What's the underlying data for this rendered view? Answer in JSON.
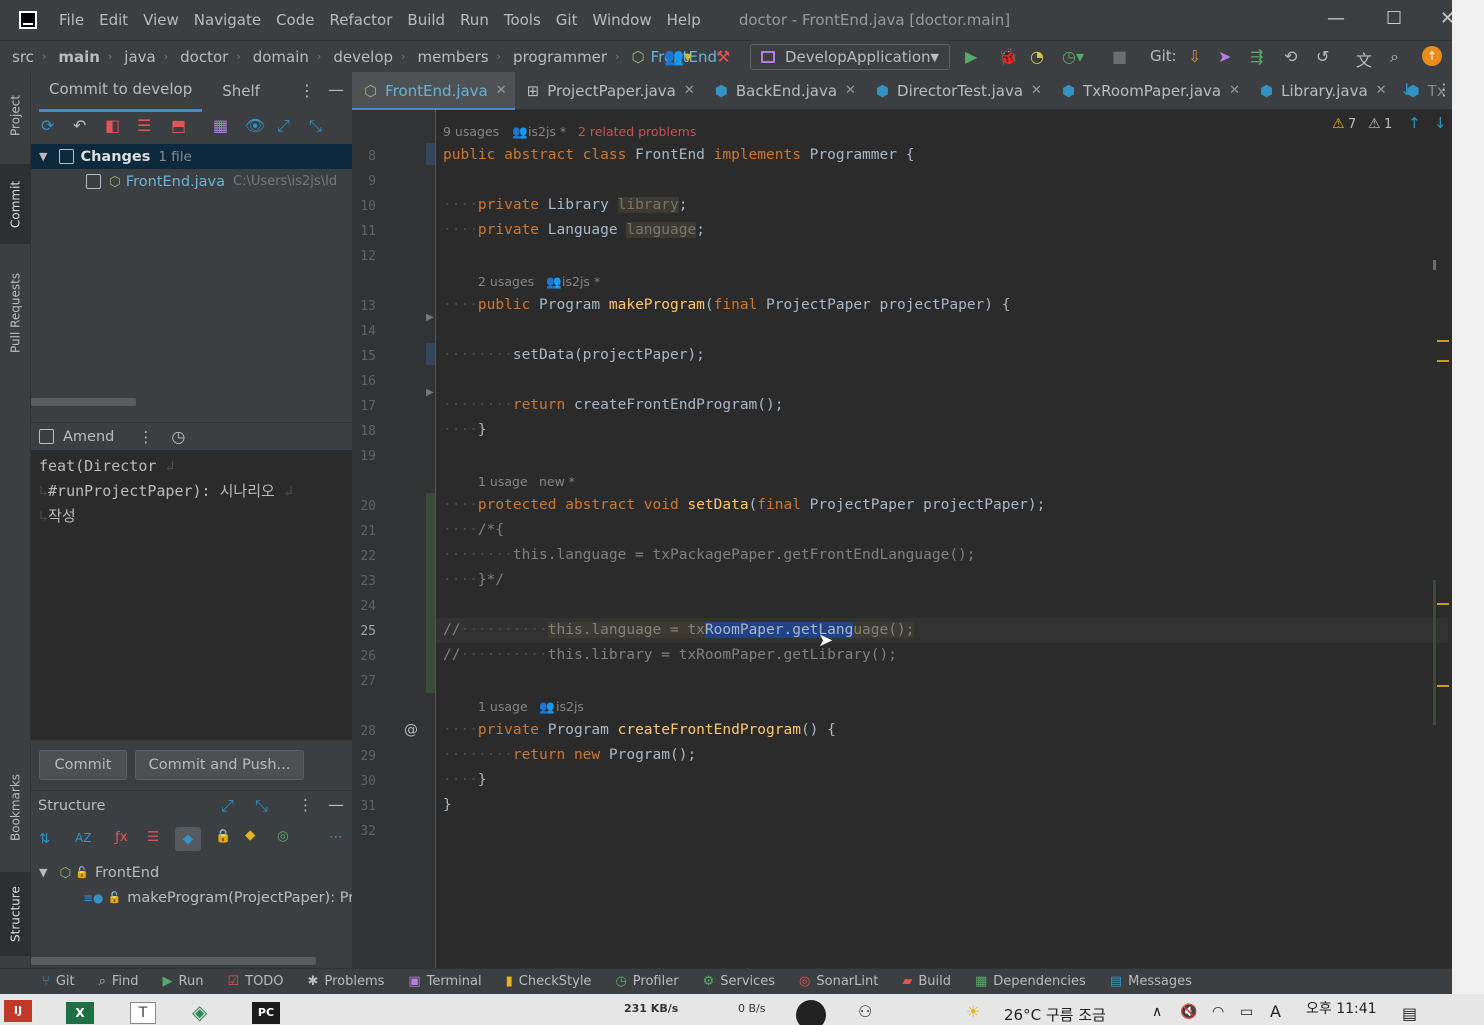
{
  "title_bar": {
    "menu": [
      "File",
      "Edit",
      "View",
      "Navigate",
      "Code",
      "Refactor",
      "Build",
      "Run",
      "Tools",
      "Git",
      "Window",
      "Help"
    ],
    "window_title": "doctor - FrontEnd.java [doctor.main]"
  },
  "nav": {
    "breadcrumbs": [
      "src",
      "main",
      "java",
      "doctor",
      "domain",
      "develop",
      "members",
      "programmer",
      "FrontEnd"
    ],
    "run_config": "DevelopApplication",
    "git_label": "Git:"
  },
  "left_strip": {
    "project": "Project",
    "commit": "Commit",
    "pull_requests": "Pull Requests",
    "bookmarks": "Bookmarks",
    "structure": "Structure"
  },
  "commit_panel": {
    "tab_commit": "Commit to develop",
    "tab_shelf": "Shelf",
    "changes_label": "Changes",
    "changes_count": "1 file",
    "file_name": "FrontEnd.java",
    "file_path": "C:\\Users\\is2js\\Id",
    "amend_label": "Amend",
    "message_line1": "feat(Director",
    "message_line2": "#runProjectPaper): 시나리오",
    "message_line3": "작성",
    "commit_button": "Commit",
    "commit_push_button": "Commit and Push..."
  },
  "structure_panel": {
    "title": "Structure",
    "root": "FrontEnd",
    "child": "makeProgram(ProjectPaper): Prog"
  },
  "editor_tabs": [
    "FrontEnd.java",
    "ProjectPaper.java",
    "BackEnd.java",
    "DirectorTest.java",
    "TxRoomPaper.java",
    "Library.java",
    "Tx"
  ],
  "editor": {
    "warnings": "7",
    "weak_warnings": "1",
    "hints": {
      "class_usages": "9 usages",
      "class_author": "is2js *",
      "class_problems": "2 related problems",
      "make_usages": "2 usages",
      "make_author": "is2js *",
      "setdata_usages": "1 usage",
      "setdata_author": "new *",
      "create_usages": "1 usage",
      "create_author": "is2js"
    },
    "line_numbers": [
      "8",
      "9",
      "10",
      "11",
      "12",
      "13",
      "14",
      "15",
      "16",
      "17",
      "18",
      "19",
      "20",
      "21",
      "22",
      "23",
      "24",
      "25",
      "26",
      "27",
      "28",
      "29",
      "30",
      "31",
      "32"
    ]
  },
  "bottom_bar": [
    "Git",
    "Find",
    "Run",
    "TODO",
    "Problems",
    "Terminal",
    "CheckStyle",
    "Profiler",
    "Services",
    "SonarLint",
    "Build",
    "Dependencies",
    "Messages"
  ],
  "taskbar": {
    "net_up": "231 KB/s",
    "net_down": "0 B/s",
    "weather": "26°C 구름 조금",
    "clock": "오후 11:41"
  },
  "colors": {
    "accent": "#4a88c7",
    "keyword": "#cc7832",
    "function": "#ffc66d",
    "field": "#9876aa"
  }
}
